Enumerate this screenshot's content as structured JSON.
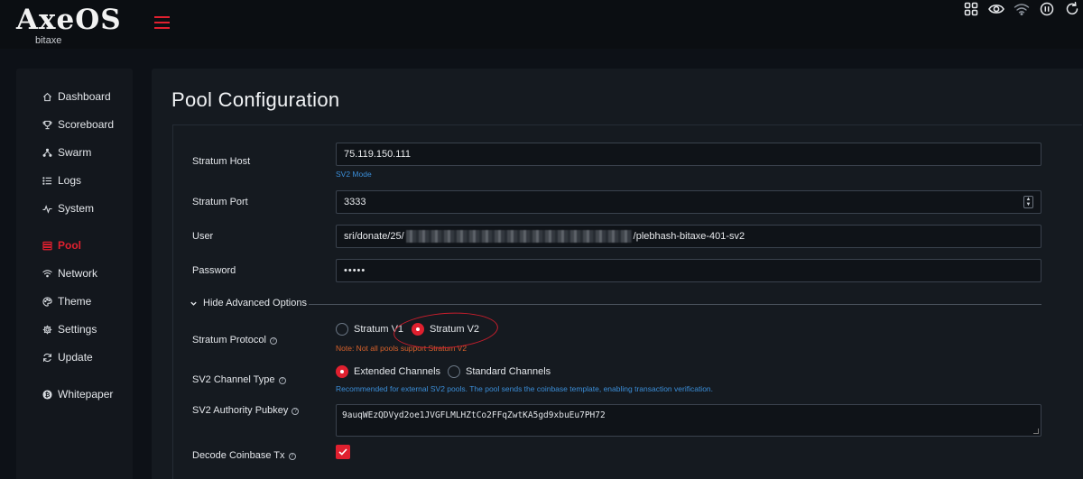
{
  "app": {
    "logo_text": "AxeOS",
    "logo_sub": "bitaxe"
  },
  "colors": {
    "accent": "#e0202f",
    "bg": "#0d1117",
    "card": "#151a20",
    "link_blue": "#3b8ed8",
    "warn_orange": "#d9622b"
  },
  "topbar": {
    "icons": [
      "grid-icon",
      "eye-icon",
      "wifi-icon",
      "pause-icon",
      "refresh-icon"
    ]
  },
  "sidebar": {
    "items": [
      {
        "label": "Dashboard",
        "icon": "home-icon"
      },
      {
        "label": "Scoreboard",
        "icon": "trophy-icon"
      },
      {
        "label": "Swarm",
        "icon": "network-icon"
      },
      {
        "label": "Logs",
        "icon": "list-icon"
      },
      {
        "label": "System",
        "icon": "pulse-icon"
      },
      {
        "label": "Pool",
        "icon": "server-icon",
        "active": true
      },
      {
        "label": "Network",
        "icon": "wifi-icon"
      },
      {
        "label": "Theme",
        "icon": "palette-icon"
      },
      {
        "label": "Settings",
        "icon": "gear-icon"
      },
      {
        "label": "Update",
        "icon": "sync-icon"
      },
      {
        "label": "Whitepaper",
        "icon": "bitcoin-icon"
      }
    ]
  },
  "page": {
    "title": "Pool Configuration"
  },
  "form": {
    "stratum_host": {
      "label": "Stratum Host",
      "value": "75.119.150.111",
      "hint": "SV2 Mode"
    },
    "stratum_port": {
      "label": "Stratum Port",
      "value": "3333"
    },
    "user": {
      "label": "User",
      "value_prefix": "sri/donate/25/",
      "value_suffix": "/plebhash-bitaxe-401-sv2"
    },
    "password": {
      "label": "Password",
      "value": "•••••"
    },
    "advanced_toggle": "Hide Advanced Options",
    "protocol": {
      "label": "Stratum Protocol",
      "options": [
        "Stratum V1",
        "Stratum V2"
      ],
      "selected": "Stratum V2",
      "note": "Note: Not all pools support Stratum V2"
    },
    "channel_type": {
      "label": "SV2 Channel Type",
      "options": [
        "Extended Channels",
        "Standard Channels"
      ],
      "selected": "Extended Channels",
      "hint": "Recommended for external SV2 pools. The pool sends the coinbase template, enabling transaction verification."
    },
    "authority_pubkey": {
      "label": "SV2 Authority Pubkey",
      "value": "9auqWEzQDVyd2oe1JVGFLMLHZtCo2FFqZwtKA5gd9xbuEu7PH72"
    },
    "decode_coinbase": {
      "label": "Decode Coinbase Tx",
      "checked": true
    }
  }
}
